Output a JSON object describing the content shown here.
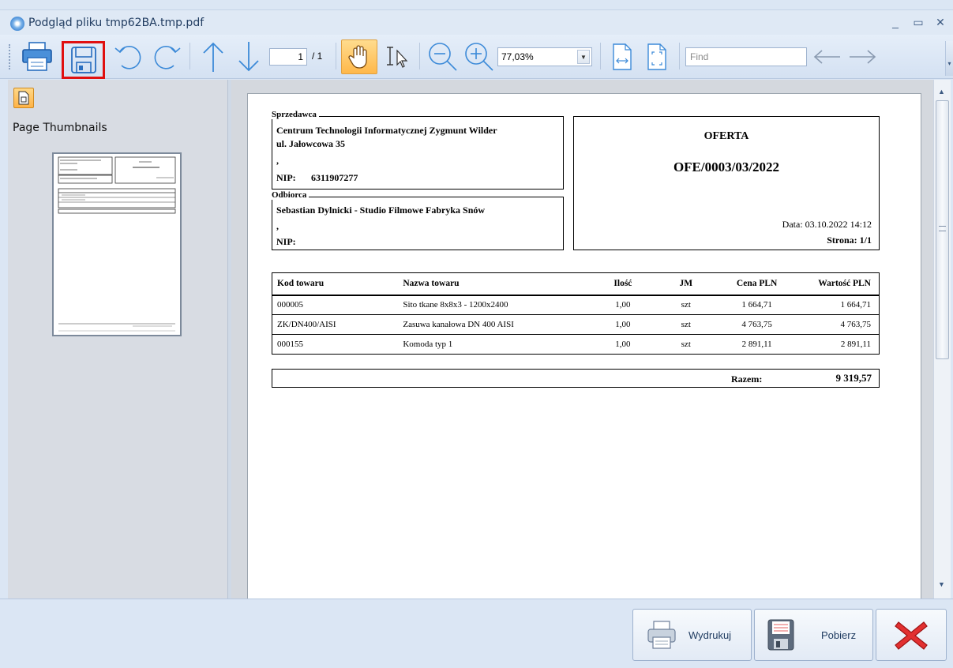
{
  "window": {
    "title": "Podgląd pliku tmp62BA.tmp.pdf"
  },
  "toolbar": {
    "page_current": "1",
    "page_total": "/ 1",
    "zoom": "77,03%",
    "find_placeholder": "Find"
  },
  "left_panel": {
    "label": "Page Thumbnails"
  },
  "document": {
    "seller_legend": "Sprzedawca",
    "seller_name": "Centrum Technologii Informatycznej Zygmunt Wilder",
    "seller_address": "ul. Jałowcowa 35",
    "seller_comma": ",",
    "seller_nip_label": "NIP:",
    "seller_nip": "6311907277",
    "buyer_legend": "Odbiorca",
    "buyer_name": "Sebastian Dylnicki - Studio Filmowe Fabryka Snów",
    "buyer_comma": ",",
    "buyer_nip_label": "NIP:",
    "doc_type": "OFERTA",
    "doc_number": "OFE/0003/03/2022",
    "date": "Data: 03.10.2022 14:12",
    "page": "Strona: 1/1",
    "headers": {
      "code": "Kod towaru",
      "name": "Nazwa towaru",
      "qty": "Ilość",
      "unit": "JM",
      "price": "Cena PLN",
      "value": "Wartość PLN"
    },
    "rows": [
      {
        "code": "000005",
        "name": "Sito tkane 8x8x3 - 1200x2400",
        "qty": "1,00",
        "unit": "szt",
        "price": "1 664,71",
        "value": "1 664,71"
      },
      {
        "code": "ZK/DN400/AISI",
        "name": "Zasuwa kanałowa DN 400 AISI",
        "qty": "1,00",
        "unit": "szt",
        "price": "4 763,75",
        "value": "4 763,75"
      },
      {
        "code": "000155",
        "name": "Komoda typ 1",
        "qty": "1,00",
        "unit": "szt",
        "price": "2 891,11",
        "value": "2 891,11"
      }
    ],
    "total_label": "Razem:",
    "total_value": "9 319,57"
  },
  "bottom": {
    "print_label": "Wydrukuj",
    "download_label": "Pobierz"
  },
  "colors": {
    "highlight_red": "#e01010",
    "active_orange": "#ffc25a"
  }
}
